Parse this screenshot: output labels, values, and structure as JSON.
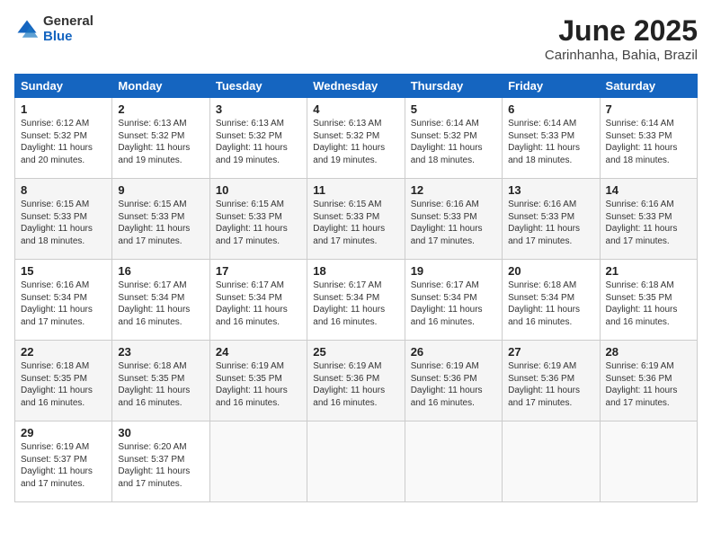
{
  "logo": {
    "general": "General",
    "blue": "Blue"
  },
  "header": {
    "month": "June 2025",
    "location": "Carinhanha, Bahia, Brazil"
  },
  "weekdays": [
    "Sunday",
    "Monday",
    "Tuesday",
    "Wednesday",
    "Thursday",
    "Friday",
    "Saturday"
  ],
  "weeks": [
    [
      {
        "day": "1",
        "info": "Sunrise: 6:12 AM\nSunset: 5:32 PM\nDaylight: 11 hours\nand 20 minutes."
      },
      {
        "day": "2",
        "info": "Sunrise: 6:13 AM\nSunset: 5:32 PM\nDaylight: 11 hours\nand 19 minutes."
      },
      {
        "day": "3",
        "info": "Sunrise: 6:13 AM\nSunset: 5:32 PM\nDaylight: 11 hours\nand 19 minutes."
      },
      {
        "day": "4",
        "info": "Sunrise: 6:13 AM\nSunset: 5:32 PM\nDaylight: 11 hours\nand 19 minutes."
      },
      {
        "day": "5",
        "info": "Sunrise: 6:14 AM\nSunset: 5:32 PM\nDaylight: 11 hours\nand 18 minutes."
      },
      {
        "day": "6",
        "info": "Sunrise: 6:14 AM\nSunset: 5:33 PM\nDaylight: 11 hours\nand 18 minutes."
      },
      {
        "day": "7",
        "info": "Sunrise: 6:14 AM\nSunset: 5:33 PM\nDaylight: 11 hours\nand 18 minutes."
      }
    ],
    [
      {
        "day": "8",
        "info": "Sunrise: 6:15 AM\nSunset: 5:33 PM\nDaylight: 11 hours\nand 18 minutes."
      },
      {
        "day": "9",
        "info": "Sunrise: 6:15 AM\nSunset: 5:33 PM\nDaylight: 11 hours\nand 17 minutes."
      },
      {
        "day": "10",
        "info": "Sunrise: 6:15 AM\nSunset: 5:33 PM\nDaylight: 11 hours\nand 17 minutes."
      },
      {
        "day": "11",
        "info": "Sunrise: 6:15 AM\nSunset: 5:33 PM\nDaylight: 11 hours\nand 17 minutes."
      },
      {
        "day": "12",
        "info": "Sunrise: 6:16 AM\nSunset: 5:33 PM\nDaylight: 11 hours\nand 17 minutes."
      },
      {
        "day": "13",
        "info": "Sunrise: 6:16 AM\nSunset: 5:33 PM\nDaylight: 11 hours\nand 17 minutes."
      },
      {
        "day": "14",
        "info": "Sunrise: 6:16 AM\nSunset: 5:33 PM\nDaylight: 11 hours\nand 17 minutes."
      }
    ],
    [
      {
        "day": "15",
        "info": "Sunrise: 6:16 AM\nSunset: 5:34 PM\nDaylight: 11 hours\nand 17 minutes."
      },
      {
        "day": "16",
        "info": "Sunrise: 6:17 AM\nSunset: 5:34 PM\nDaylight: 11 hours\nand 16 minutes."
      },
      {
        "day": "17",
        "info": "Sunrise: 6:17 AM\nSunset: 5:34 PM\nDaylight: 11 hours\nand 16 minutes."
      },
      {
        "day": "18",
        "info": "Sunrise: 6:17 AM\nSunset: 5:34 PM\nDaylight: 11 hours\nand 16 minutes."
      },
      {
        "day": "19",
        "info": "Sunrise: 6:17 AM\nSunset: 5:34 PM\nDaylight: 11 hours\nand 16 minutes."
      },
      {
        "day": "20",
        "info": "Sunrise: 6:18 AM\nSunset: 5:34 PM\nDaylight: 11 hours\nand 16 minutes."
      },
      {
        "day": "21",
        "info": "Sunrise: 6:18 AM\nSunset: 5:35 PM\nDaylight: 11 hours\nand 16 minutes."
      }
    ],
    [
      {
        "day": "22",
        "info": "Sunrise: 6:18 AM\nSunset: 5:35 PM\nDaylight: 11 hours\nand 16 minutes."
      },
      {
        "day": "23",
        "info": "Sunrise: 6:18 AM\nSunset: 5:35 PM\nDaylight: 11 hours\nand 16 minutes."
      },
      {
        "day": "24",
        "info": "Sunrise: 6:19 AM\nSunset: 5:35 PM\nDaylight: 11 hours\nand 16 minutes."
      },
      {
        "day": "25",
        "info": "Sunrise: 6:19 AM\nSunset: 5:36 PM\nDaylight: 11 hours\nand 16 minutes."
      },
      {
        "day": "26",
        "info": "Sunrise: 6:19 AM\nSunset: 5:36 PM\nDaylight: 11 hours\nand 16 minutes."
      },
      {
        "day": "27",
        "info": "Sunrise: 6:19 AM\nSunset: 5:36 PM\nDaylight: 11 hours\nand 17 minutes."
      },
      {
        "day": "28",
        "info": "Sunrise: 6:19 AM\nSunset: 5:36 PM\nDaylight: 11 hours\nand 17 minutes."
      }
    ],
    [
      {
        "day": "29",
        "info": "Sunrise: 6:19 AM\nSunset: 5:37 PM\nDaylight: 11 hours\nand 17 minutes."
      },
      {
        "day": "30",
        "info": "Sunrise: 6:20 AM\nSunset: 5:37 PM\nDaylight: 11 hours\nand 17 minutes."
      },
      null,
      null,
      null,
      null,
      null
    ]
  ]
}
